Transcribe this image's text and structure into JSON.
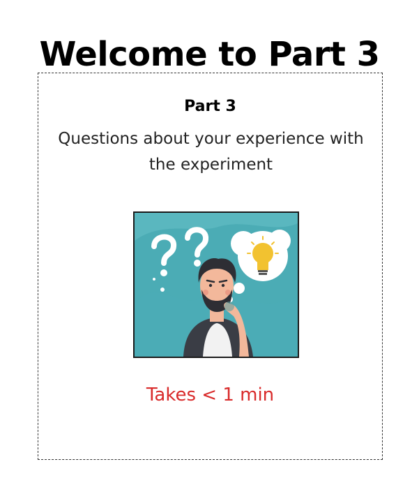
{
  "page": {
    "title": "Welcome to Part 3"
  },
  "card": {
    "heading": "Part 3",
    "description": "Questions about your experience with the experiment",
    "illustration_icon": "thinking-person-with-question-marks-and-lightbulb",
    "duration_text": "Takes < 1 min"
  },
  "colors": {
    "duration_text": "#d92b2b",
    "illustration_background": "#5ab7bf",
    "illustration_blob": "#3fa4ad",
    "lightbulb": "#f2c230"
  }
}
